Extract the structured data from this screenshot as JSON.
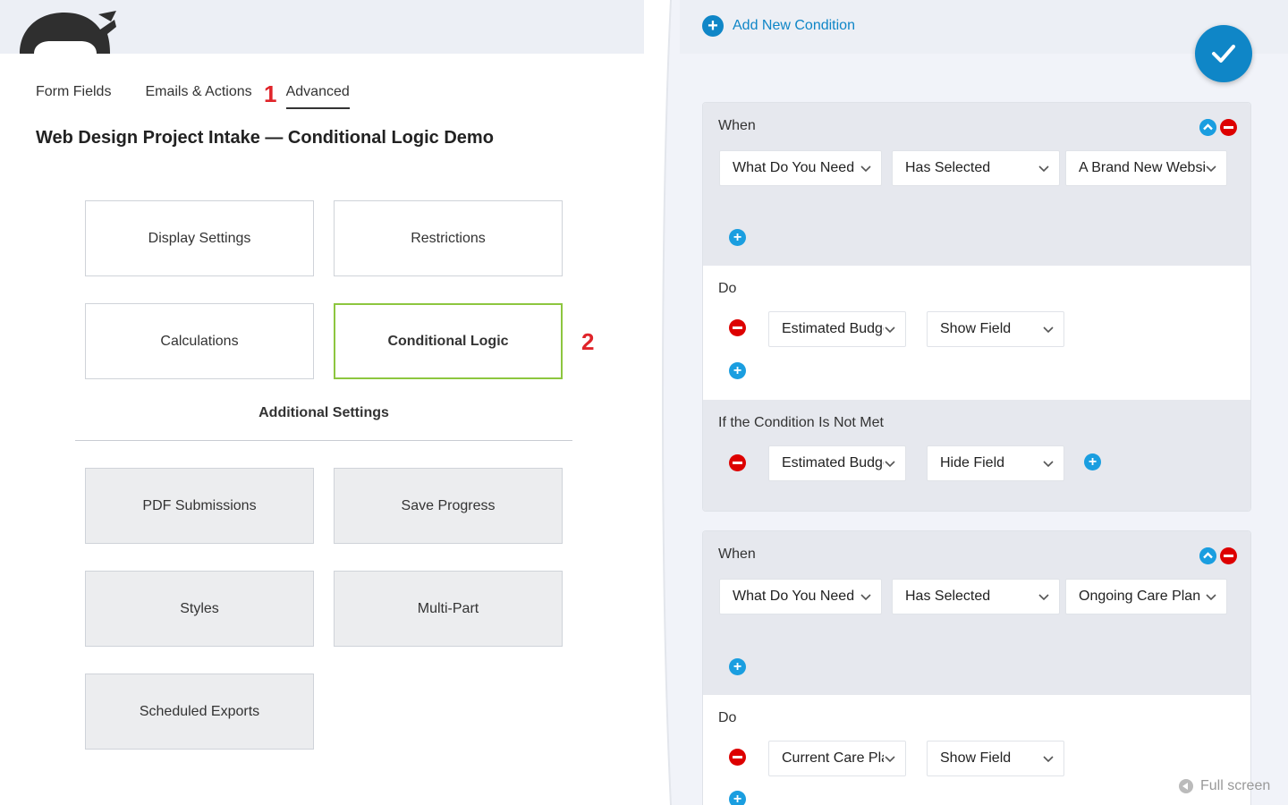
{
  "tabs": [
    {
      "label": "Form Fields",
      "active": false
    },
    {
      "label": "Emails & Actions",
      "active": false
    },
    {
      "label": "Advanced",
      "active": true
    }
  ],
  "annotations": {
    "mark1": "1",
    "mark2": "2"
  },
  "page_title": "Web Design Project Intake — Conditional Logic Demo",
  "cards": {
    "display_settings": "Display Settings",
    "restrictions": "Restrictions",
    "calculations": "Calculations",
    "conditional_logic": "Conditional Logic"
  },
  "additional_settings_label": "Additional Settings",
  "additional_cards": {
    "pdf": "PDF Submissions",
    "save_progress": "Save Progress",
    "styles": "Styles",
    "multi_part": "Multi-Part",
    "scheduled_exports": "Scheduled Exports"
  },
  "drawer": {
    "add_condition": "Add New Condition",
    "full_screen": "Full screen",
    "conditions": [
      {
        "when_label": "When",
        "when": {
          "field": "What Do You Need",
          "comparator": "Has Selected",
          "value": "A Brand New Website"
        },
        "do_label": "Do",
        "do": {
          "field": "Estimated Budget",
          "action": "Show Field"
        },
        "else_label": "If the Condition Is Not Met",
        "else": {
          "field": "Estimated Budget",
          "action": "Hide Field"
        }
      },
      {
        "when_label": "When",
        "when": {
          "field": "What Do You Need",
          "comparator": "Has Selected",
          "value": "Ongoing Care Plan"
        },
        "do_label": "Do",
        "do": {
          "field": "Current Care Plan",
          "action": "Show Field"
        }
      }
    ]
  },
  "colors": {
    "accent": "#0f86c7",
    "selected_border": "#8dc63f",
    "annotation": "#e0242a",
    "remove": "#dd0000"
  }
}
